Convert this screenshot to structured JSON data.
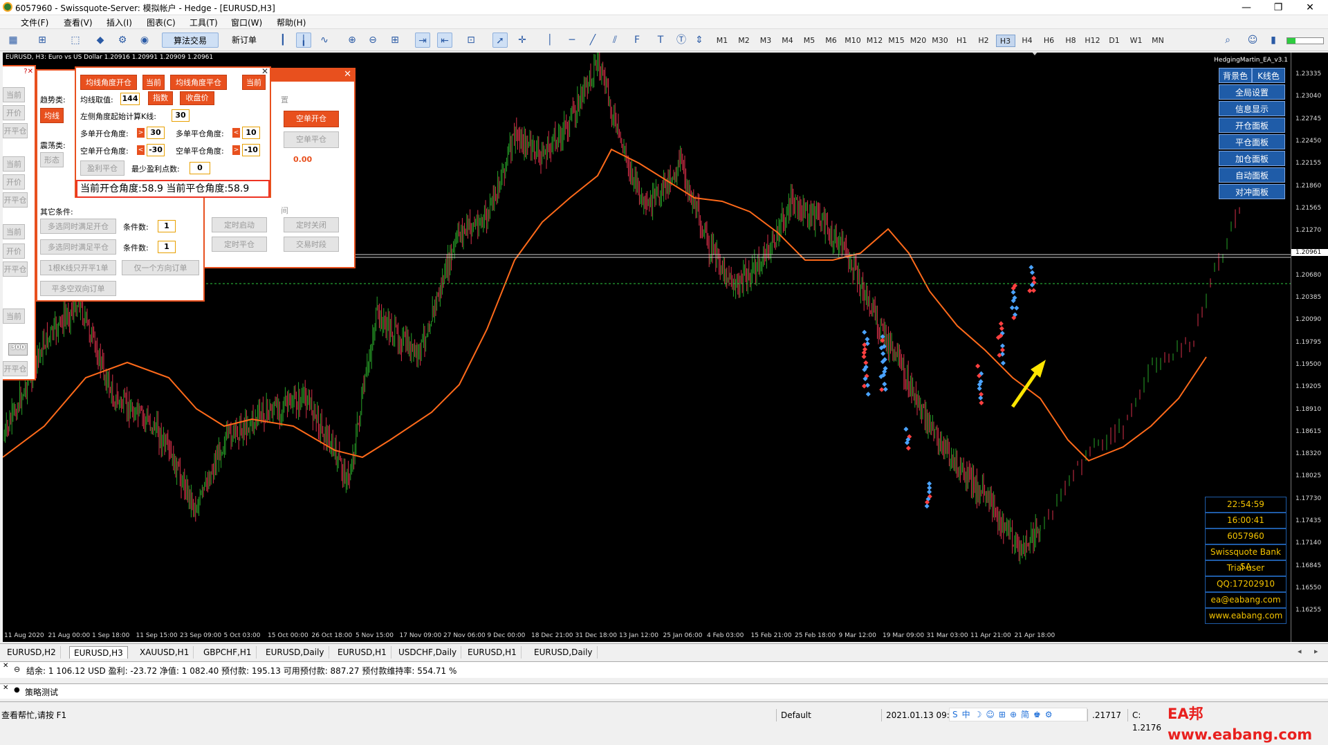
{
  "window": {
    "title": "6057960 - Swissquote-Server: 模拟帐户 - Hedge - [EURUSD,H3]",
    "min": "—",
    "max": "❐",
    "close": "✕"
  },
  "menus": [
    "文件(F)",
    "查看(V)",
    "插入(I)",
    "图表(C)",
    "工具(T)",
    "窗口(W)",
    "帮助(H)"
  ],
  "toolbar": {
    "algo_label": "算法交易",
    "new_order_label": "新订单",
    "timeframes": [
      "M1",
      "M2",
      "M3",
      "M4",
      "M5",
      "M6",
      "M10",
      "M12",
      "M15",
      "M20",
      "M30",
      "H1",
      "H2",
      "H3",
      "H4",
      "H6",
      "H8",
      "H12",
      "D1",
      "W1",
      "MN"
    ],
    "active_tf": "H3"
  },
  "chart": {
    "symbol_header": "EURUSD, H3:  Euro vs US Dollar  1.20916 1.20991 1.20909 1.20961",
    "ea_name": "HedgingMartin_EA_v3.1",
    "price_ticks": [
      "1.23335",
      "1.23040",
      "1.22745",
      "1.22450",
      "1.22155",
      "1.21860",
      "1.21565",
      "1.21270",
      "1.20961",
      "1.20680",
      "1.20385",
      "1.20090",
      "1.19795",
      "1.19500",
      "1.19205",
      "1.18910",
      "1.18615",
      "1.18320",
      "1.18025",
      "1.17730",
      "1.17435",
      "1.17140",
      "1.16845",
      "1.16550",
      "1.16255"
    ],
    "current_price": "1.20961",
    "time_ticks": [
      "11 Aug 2020",
      "21 Aug 00:00",
      "1 Sep 18:00",
      "11 Sep 15:00",
      "23 Sep 09:00",
      "5 Oct 03:00",
      "15 Oct 00:00",
      "26 Oct 18:00",
      "5 Nov 15:00",
      "17 Nov 09:00",
      "27 Nov 06:00",
      "9 Dec 00:00",
      "18 Dec 21:00",
      "31 Dec 18:00",
      "13 Jan 12:00",
      "25 Jan 06:00",
      "4 Feb 03:00",
      "15 Feb 21:00",
      "25 Feb 18:00",
      "9 Mar 12:00",
      "19 Mar 09:00",
      "31 Mar 03:00",
      "11 Apr 21:00",
      "21 Apr 18:00"
    ],
    "trend_panel": {
      "btn_ma_open": "均线角度开仓",
      "btn_current": "当前",
      "btn_ma_close": "均线角度平仓",
      "btn_current2": "当前",
      "ma_period_label": "均线取值:",
      "ma_period": "144",
      "btn_exp": "指数",
      "btn_close_price": "收盘价",
      "left_angle_label": "左侧角度起始计算K线:",
      "left_angle": "30",
      "long_open_label": "多单开仓角度:",
      "long_open": "30",
      "long_close_label": "多单平仓角度:",
      "long_close": "10",
      "short_open_label": "空单开仓角度:",
      "short_open": "-30",
      "short_close_label": "空单平仓角度:",
      "short_close": "-10",
      "btn_profit_close": "盈利平仓",
      "min_profit_label": "最少盈利点数:",
      "min_profit": "0",
      "current_angles": "当前开仓角度:58.9 当前平仓角度:58.9"
    },
    "cond_panel": {
      "trend_label": "趋势类:",
      "btn_ma": "均线",
      "range_label": "震荡类:",
      "btn_shape": "形态",
      "other_label": "其它条件:",
      "btn_multi_open": "多选同时满足开仓",
      "cond_count_label": "条件数:",
      "cond_count": "1",
      "btn_multi_close": "多选同时满足平仓",
      "cond_count2": "1",
      "btn_one_kline": "1根K线只开平1单",
      "btn_one_dir": "仅一个方向订单",
      "btn_flat_empty": "平多空双向订单"
    },
    "order_panel": {
      "label_set": "置",
      "btn_short_open": "空单开仓",
      "btn_short_close": "空单平仓",
      "value": "0.00",
      "label_time": "间",
      "btn_timer_start": "定时启动",
      "btn_timer_close": "定时关闭",
      "btn_timer_flat": "定时平仓",
      "btn_trade_time": "交易时段"
    },
    "left_panel": {
      "btn1": "当前",
      "btn2": "开价",
      "btn3": "开平仓",
      "btn4": "当前",
      "btn5": "开价",
      "btn6": "开平仓",
      "btn7": "当前",
      "btn8": "开价",
      "btn9": "开平仓",
      "btn10": "当前",
      "value": "300",
      "btn11": "开平仓"
    },
    "right_buttons": [
      "背景色",
      "K线色",
      "全局设置",
      "信息显示",
      "开仓面板",
      "平仓面板",
      "加仓面板",
      "自动面板",
      "对冲面板"
    ],
    "info_box": [
      "22:54:59",
      "16:00:41",
      "6057960",
      "Swissquote Bank SA",
      "Trial user",
      "QQ:17202910",
      "ea@eabang.com",
      "www.eabang.com"
    ]
  },
  "tabs": [
    "EURUSD,H2",
    "EURUSD,H3",
    "XAUUSD,H1",
    "GBPCHF,H1",
    "EURUSD,Daily",
    "EURUSD,H1",
    "USDCHF,Daily",
    "EURUSD,H1",
    "EURUSD,Daily"
  ],
  "active_tab": "EURUSD,H3",
  "terminal": {
    "text": "结余: 1 106.12 USD  盈利: -23.72  净值: 1 082.40  预付款: 195.13  可用预付款: 887.27  预付款维持率: 554.71 %"
  },
  "tester": {
    "label": "策略测试"
  },
  "status": {
    "help": "查看帮忙,请按 F1",
    "profile": "Default",
    "datetime": "2021.01.13 09:",
    "price": ".21717",
    "close": "C: 1.2176",
    "watermark": "EA邦 www.eabang.com"
  }
}
